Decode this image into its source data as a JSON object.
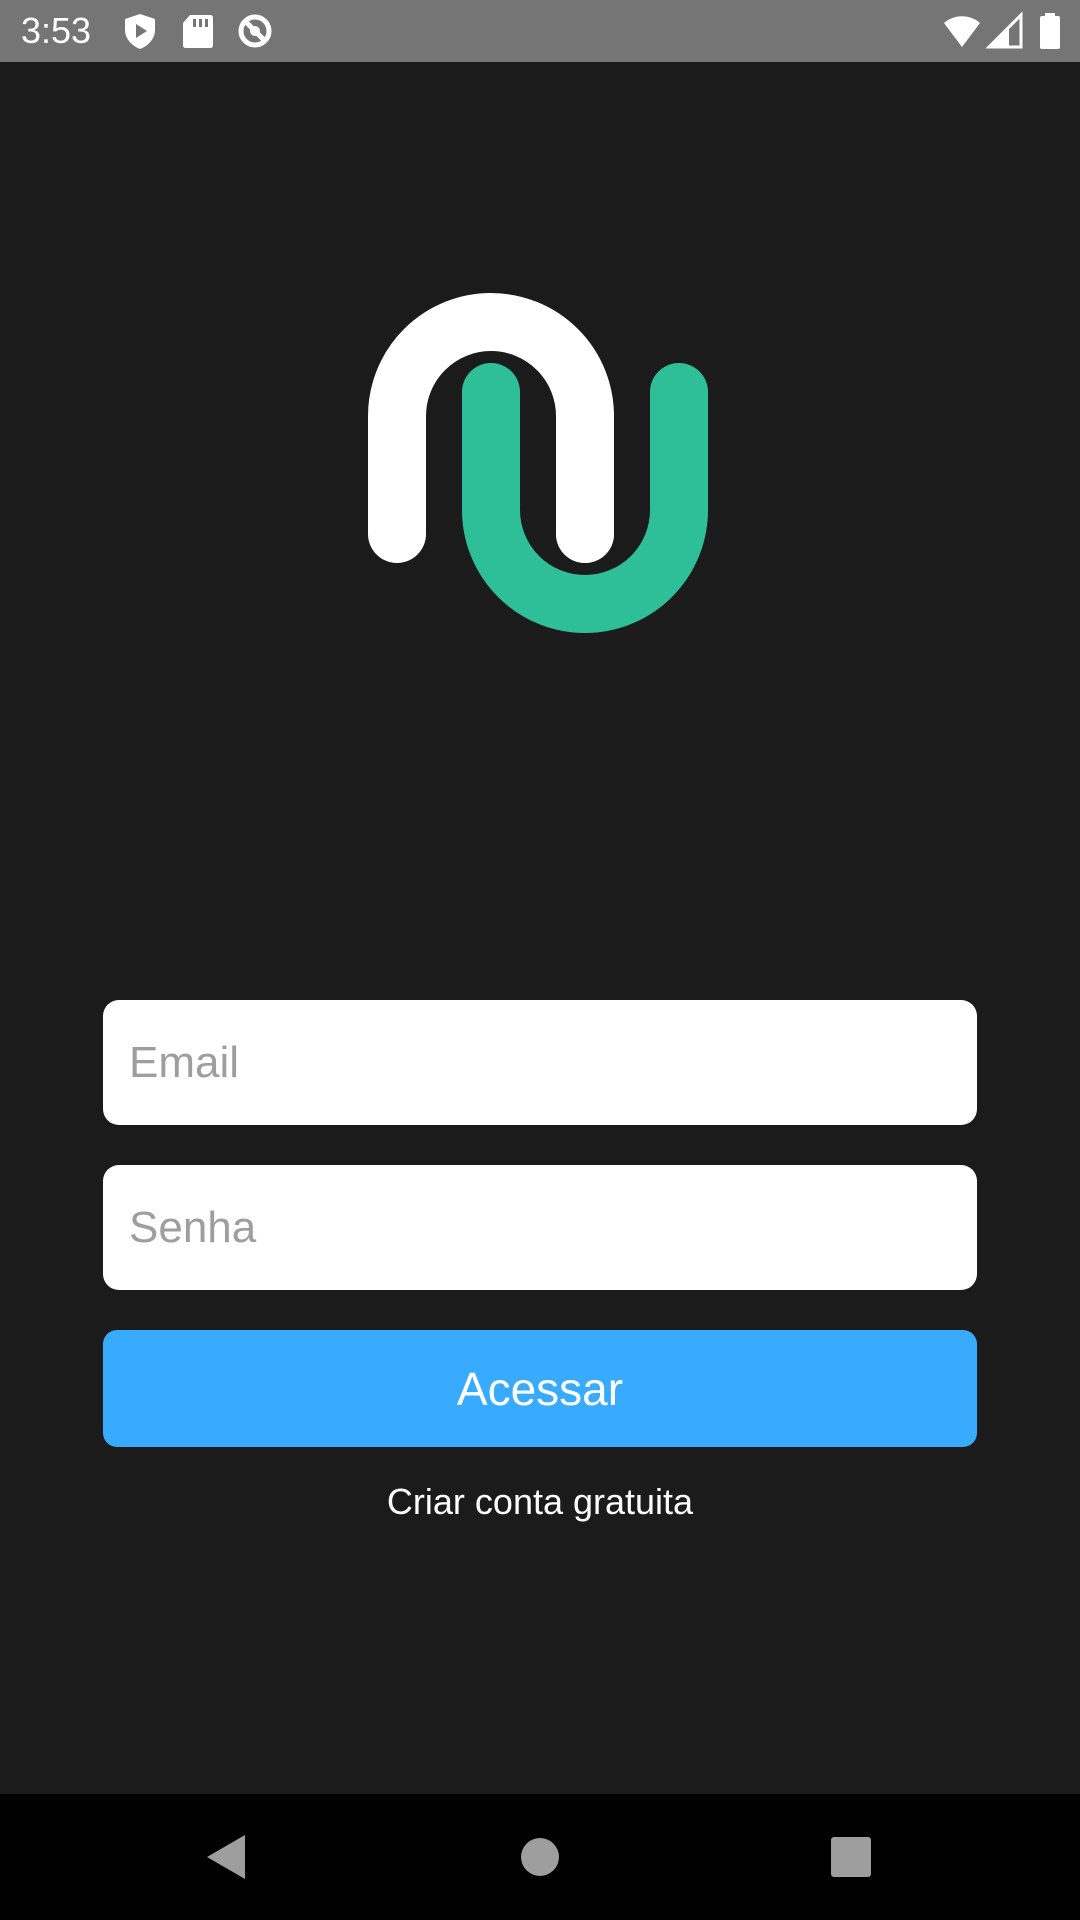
{
  "status_bar": {
    "time": "3:53",
    "left_icons": [
      "play-protect-icon",
      "sd-card-icon",
      "data-saver-icon"
    ],
    "right_icons": [
      "wifi-icon",
      "cellular-signal-icon",
      "battery-icon"
    ]
  },
  "logo": {
    "icon": "brand-logo-icon",
    "colors": {
      "white_arch": "#ffffff",
      "green_u": "#2ebf99"
    }
  },
  "login_form": {
    "email": {
      "value": "",
      "placeholder": "Email"
    },
    "password": {
      "value": "",
      "placeholder": "Senha"
    },
    "submit_label": "Acessar",
    "create_account_label": "Criar conta gratuita"
  },
  "nav_bar": {
    "icons": [
      "back-icon",
      "home-icon",
      "recents-icon"
    ]
  },
  "colors": {
    "background": "#1b1b1b",
    "status_bar": "#757575",
    "accent": "#38abff",
    "nav_bar": "#000000"
  }
}
